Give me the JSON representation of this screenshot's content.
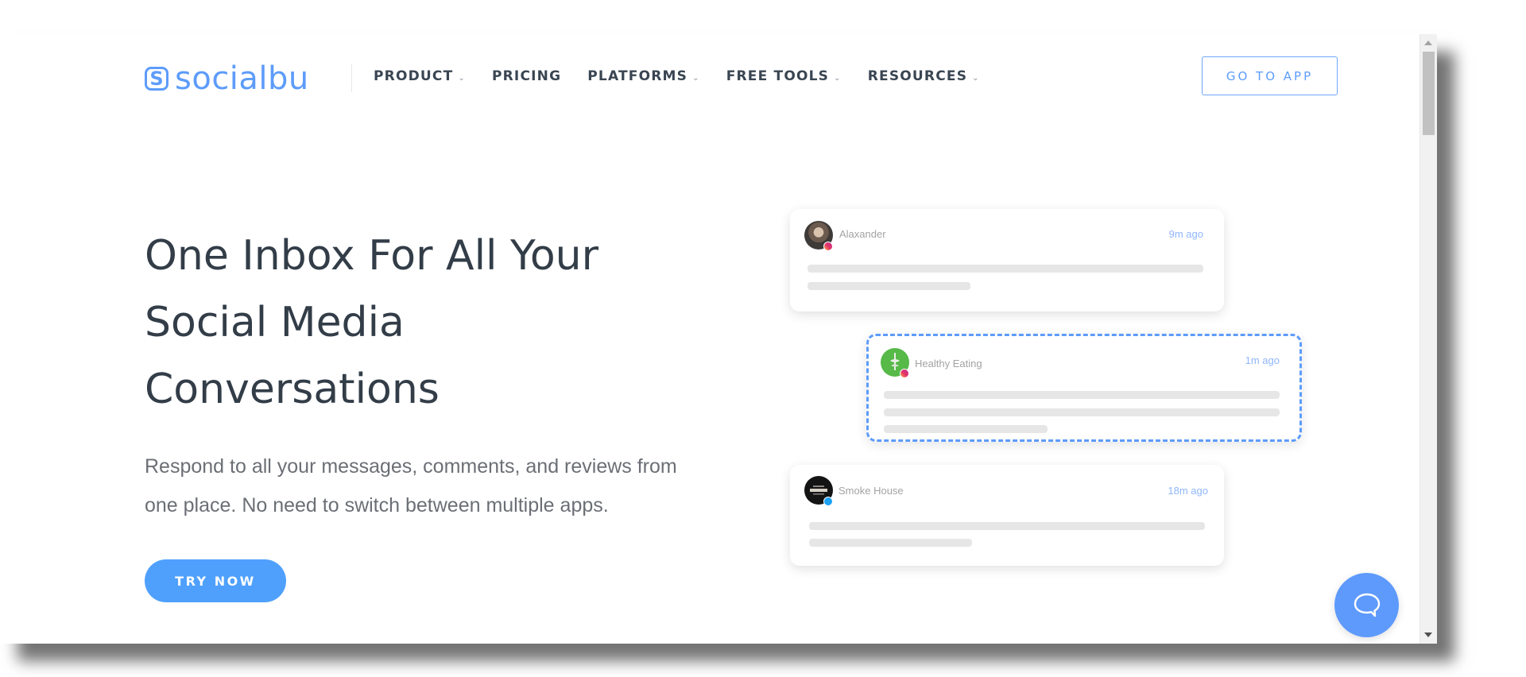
{
  "brand": {
    "name": "socialbu",
    "logo_icon": "s-logo-icon",
    "accent_color": "#5d9cfa"
  },
  "nav": {
    "items": [
      {
        "label": "PRODUCT",
        "has_dropdown": true
      },
      {
        "label": "PRICING",
        "has_dropdown": false
      },
      {
        "label": "PLATFORMS",
        "has_dropdown": true
      },
      {
        "label": "FREE TOOLS",
        "has_dropdown": true
      },
      {
        "label": "RESOURCES",
        "has_dropdown": true
      }
    ],
    "dropdown_glyph": "⌄",
    "cta_label": "GO TO APP"
  },
  "hero": {
    "headline_lines": [
      "One Inbox For All Your",
      "Social Media",
      "Conversations"
    ],
    "subtitle_lines": [
      "Respond to all your messages, comments, and reviews from",
      "one place. No need to switch between multiple apps."
    ],
    "cta_label": "TRY NOW",
    "cta_color": "#4fa0fc"
  },
  "conversations": [
    {
      "name": "Alaxander",
      "time": "9m ago",
      "platform": "instagram",
      "highlighted": false
    },
    {
      "name": "Healthy Eating",
      "time": "1m ago",
      "platform": "instagram",
      "highlighted": true
    },
    {
      "name": "Smoke House",
      "time": "18m ago",
      "platform": "twitter",
      "highlighted": false
    }
  ],
  "chat_widget": {
    "icon": "chat-bubble-icon",
    "color": "#5e9afc"
  }
}
